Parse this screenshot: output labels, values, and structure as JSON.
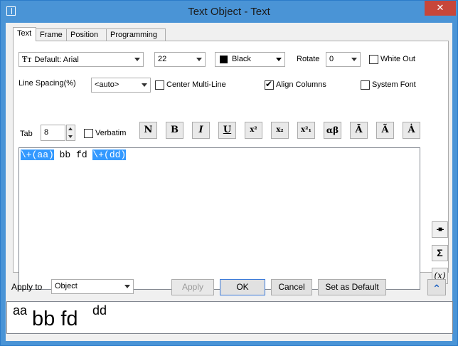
{
  "window": {
    "title": "Text Object - Text",
    "close_glyph": "✕"
  },
  "tabs": [
    {
      "label": "Text",
      "active": true
    },
    {
      "label": "Frame",
      "active": false
    },
    {
      "label": "Position",
      "active": false
    },
    {
      "label": "Programming",
      "active": false
    }
  ],
  "text_tab": {
    "font": {
      "icon": "TrueType",
      "value": "Default: Arial"
    },
    "font_size": "22",
    "color": {
      "label": "Black",
      "swatch": "#000000"
    },
    "rotate": {
      "label": "Rotate",
      "value": "0"
    },
    "white_out": {
      "label": "White Out",
      "checked": false
    },
    "line_spacing": {
      "label": "Line Spacing(%)",
      "value": "<auto>"
    },
    "center_multiline": {
      "label": "Center Multi-Line",
      "checked": false
    },
    "align_columns": {
      "label": "Align Columns",
      "checked": true
    },
    "system_font": {
      "label": "System Font",
      "checked": false
    },
    "tab": {
      "label": "Tab",
      "value": "8"
    },
    "verbatim": {
      "label": "Verbatim",
      "checked": false
    },
    "format_buttons": [
      "N",
      "B",
      "I",
      "U",
      "x²",
      "x₂",
      "x²₁",
      "αβ",
      "Ā",
      "Ã",
      "Ȧ"
    ],
    "editor": {
      "seg1": "\\+(aa)",
      "seg2": " bb fd ",
      "seg3": "\\+(dd)"
    },
    "side_buttons": [
      "-■-",
      "Σ",
      "(x)"
    ]
  },
  "footer": {
    "apply_to_label": "Apply to",
    "apply_to_value": "Object",
    "apply": "Apply",
    "ok": "OK",
    "cancel": "Cancel",
    "set_default": "Set as Default",
    "collapse_glyph": "⌃"
  },
  "preview": {
    "sup1": "aa",
    "main": "bb fd",
    "sup2": "dd"
  }
}
